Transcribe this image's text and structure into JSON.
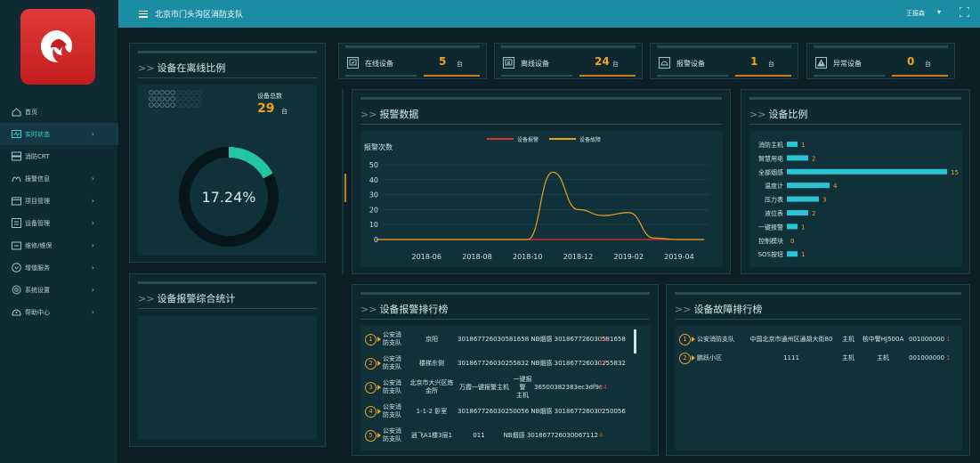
{
  "header": {
    "title": "北京市门头沟区消防支队",
    "user": "王振森"
  },
  "sidebar": {
    "items": [
      {
        "label": "首页",
        "icon": "home-icon",
        "arrow": false
      },
      {
        "label": "实时状态",
        "icon": "pulse-icon",
        "arrow": true,
        "active": true
      },
      {
        "label": "消防CRT",
        "icon": "monitor-icon",
        "arrow": false
      },
      {
        "label": "报警信息",
        "icon": "alarm-icon",
        "arrow": true
      },
      {
        "label": "项目管理",
        "icon": "project-icon",
        "arrow": true
      },
      {
        "label": "设备管理",
        "icon": "device-icon",
        "arrow": true
      },
      {
        "label": "维修/维保",
        "icon": "wrench-icon",
        "arrow": true
      },
      {
        "label": "增值服务",
        "icon": "service-icon",
        "arrow": true
      },
      {
        "label": "系统设置",
        "icon": "settings-icon",
        "arrow": true
      },
      {
        "label": "帮助中心",
        "icon": "help-icon",
        "arrow": true
      }
    ]
  },
  "online_ratio": {
    "title": "设备在离线比例",
    "total_label": "设备总数",
    "total_value": "29",
    "total_unit": "台",
    "percent_text": "17.24%",
    "percent": 0.1724
  },
  "alarm_stats": {
    "title": "设备报警综合统计"
  },
  "stats": [
    {
      "label": "在线设备",
      "value": "5",
      "unit": "台",
      "icon": "online-icon"
    },
    {
      "label": "离线设备",
      "value": "24",
      "unit": "台",
      "icon": "offline-icon"
    },
    {
      "label": "报警设备",
      "value": "1",
      "unit": "台",
      "icon": "alarm-device-icon"
    },
    {
      "label": "异常设备",
      "value": "0",
      "unit": "台",
      "icon": "warning-icon"
    }
  ],
  "alarm_data": {
    "title": "报警数据",
    "legend": [
      "设备报警",
      "设备故障"
    ],
    "ylabel": "报警次数"
  },
  "device_ratio": {
    "title": "设备比例"
  },
  "alarm_rank": {
    "title": "设备报警排行榜",
    "rows": [
      {
        "rank": "1",
        "org1": "公安消",
        "org2": "防支队",
        "place": "京阳",
        "text": "301867726030581658 NB烟感 301867726030581658",
        "count": "24"
      },
      {
        "rank": "2",
        "org1": "公安消",
        "org2": "防支队",
        "place": "楼梯东侧",
        "text": "301867726030255832 NB烟感 301867726030255832",
        "count": "17"
      },
      {
        "rank": "3",
        "org1": "公安消",
        "org2": "防支队",
        "place1": "北京市大兴区炼",
        "place2": "金所",
        "mid": "万霞一键报警主机",
        "mid1": "一键报警",
        "mid2": "主机",
        "code": "36500382383ec3df9c",
        "count": "14"
      },
      {
        "rank": "4",
        "org1": "公安消",
        "org2": "防支队",
        "place": "1-1-2 卧室",
        "text": "301867726030250056 NB烟感 301867726030250056",
        "count": "7"
      },
      {
        "rank": "5",
        "org1": "公安消",
        "org2": "防支队",
        "place": "逍飞A1楼3层1",
        "mid": "011",
        "text": "NB烟感 301867726030067112",
        "count": "4"
      }
    ]
  },
  "fault_rank": {
    "title": "设备故障排行榜",
    "rows": [
      {
        "rank": "1",
        "org": "公安消防支队",
        "place": "中国北京市通州区通胡大街80",
        "type": "主机",
        "model": "核中警HJ500A",
        "code": "001000000",
        "count": "1"
      },
      {
        "rank": "2",
        "org": "鹏跃小区",
        "place": "1111",
        "type": "主机",
        "model": "主机",
        "code": "001000000",
        "count": "1"
      }
    ]
  },
  "chart_data": [
    {
      "type": "line",
      "title": "报警数据",
      "ylabel": "报警次数",
      "ylim": [
        0,
        50
      ],
      "yticks": [
        0,
        10,
        20,
        30,
        40,
        50
      ],
      "xticks": [
        "2018-06",
        "2018-08",
        "2018-10",
        "2018-12",
        "2019-02",
        "2019-04"
      ],
      "series": [
        {
          "name": "设备报警",
          "color": "#e0322a",
          "x": [
            "2018-04",
            "2018-06",
            "2018-08",
            "2018-10",
            "2018-12",
            "2019-02",
            "2019-04",
            "2019-05"
          ],
          "y": [
            0,
            0,
            0,
            0,
            0,
            0,
            0,
            0
          ]
        },
        {
          "name": "设备故障",
          "color": "#e8a21c",
          "x": [
            "2018-04",
            "2018-06",
            "2018-08",
            "2018-09",
            "2018-10",
            "2018-11",
            "2018-12",
            "2019-01",
            "2019-02",
            "2019-03",
            "2019-04",
            "2019-05"
          ],
          "y": [
            0,
            0,
            0,
            0,
            0,
            45,
            20,
            16,
            18,
            1,
            0,
            0
          ]
        }
      ],
      "grid": true,
      "legend": "top"
    },
    {
      "type": "bar",
      "title": "设备比例",
      "orientation": "horizontal",
      "categories": [
        "消防主机",
        "智慧用电",
        "全部烟感",
        "温度计",
        "压力表",
        "液位表",
        "一键报警",
        "控制模块",
        "SOS按钮"
      ],
      "values": [
        1,
        2,
        15,
        4,
        3,
        2,
        1,
        0,
        1
      ],
      "xlim": [
        0,
        15
      ],
      "bar_color": "#2bc4d4",
      "label_color": "#f0a31c"
    }
  ],
  "colors": {
    "accent": "#1a8da4",
    "alarm": "#e0322a",
    "fault": "#e8a21c",
    "bar": "#2bc4d4",
    "value": "#f0a31c"
  }
}
